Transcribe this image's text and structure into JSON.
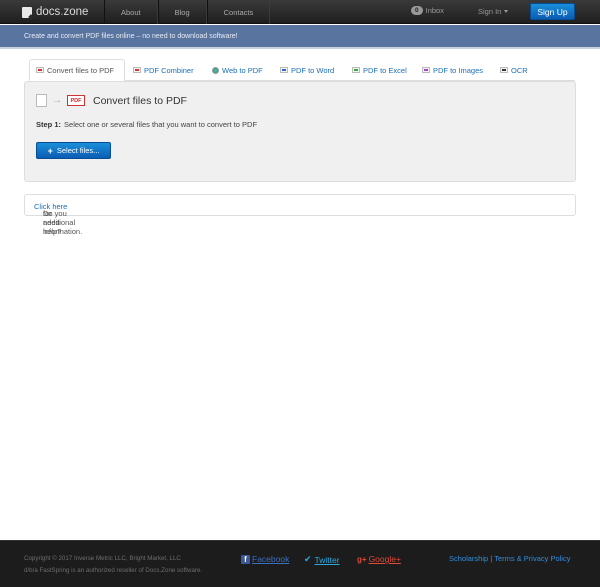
{
  "navbar": {
    "brand": "docs",
    "brand_dot": ".",
    "brand_suffix": "zone",
    "links": [
      "About",
      "Blog",
      "Contacts"
    ],
    "inbox_count": "0",
    "inbox_label": "Inbox",
    "signin_label": "Sign In",
    "signup_label": "Sign Up"
  },
  "subheader": {
    "tagline": "Create and convert PDF files online – no need to download software!"
  },
  "tabs": [
    {
      "label": "Convert files to PDF",
      "active": true
    },
    {
      "label": "PDF Combiner"
    },
    {
      "label": "Web to PDF"
    },
    {
      "label": "PDF to Word"
    },
    {
      "label": "PDF to Excel"
    },
    {
      "label": "PDF to Images"
    },
    {
      "label": "OCR"
    }
  ],
  "panel": {
    "pdf_badge": "PDF",
    "title": "Convert files to PDF",
    "step_label": "Step 1:",
    "step_text": "Select one or several files that you want to convert to PDF",
    "select_button": "Select files..."
  },
  "help": {
    "prefix": "Do you need help?",
    "link": "Click here",
    "suffix": "for additional information."
  },
  "footer": {
    "copyright_line1": "Copyright © 2017 Inverse Metric LLC, Bright Market, LLC",
    "copyright_line2": "d/b/a FastSpring is an authorized reseller of Docs.Zone software.",
    "facebook": "Facebook",
    "twitter": "Twitter",
    "google": "Google+",
    "scholarship": "Scholarship",
    "separator": "|",
    "terms": "Terms & Privacy Policy"
  },
  "colors": {
    "navbar_bg": "#2a2a2a",
    "subheader_bg": "#5a74a0",
    "accent_blue": "#0b70c9",
    "link_blue": "#1a6eb8",
    "facebook_blue": "#3b5998",
    "google_red": "#dd4b39"
  }
}
